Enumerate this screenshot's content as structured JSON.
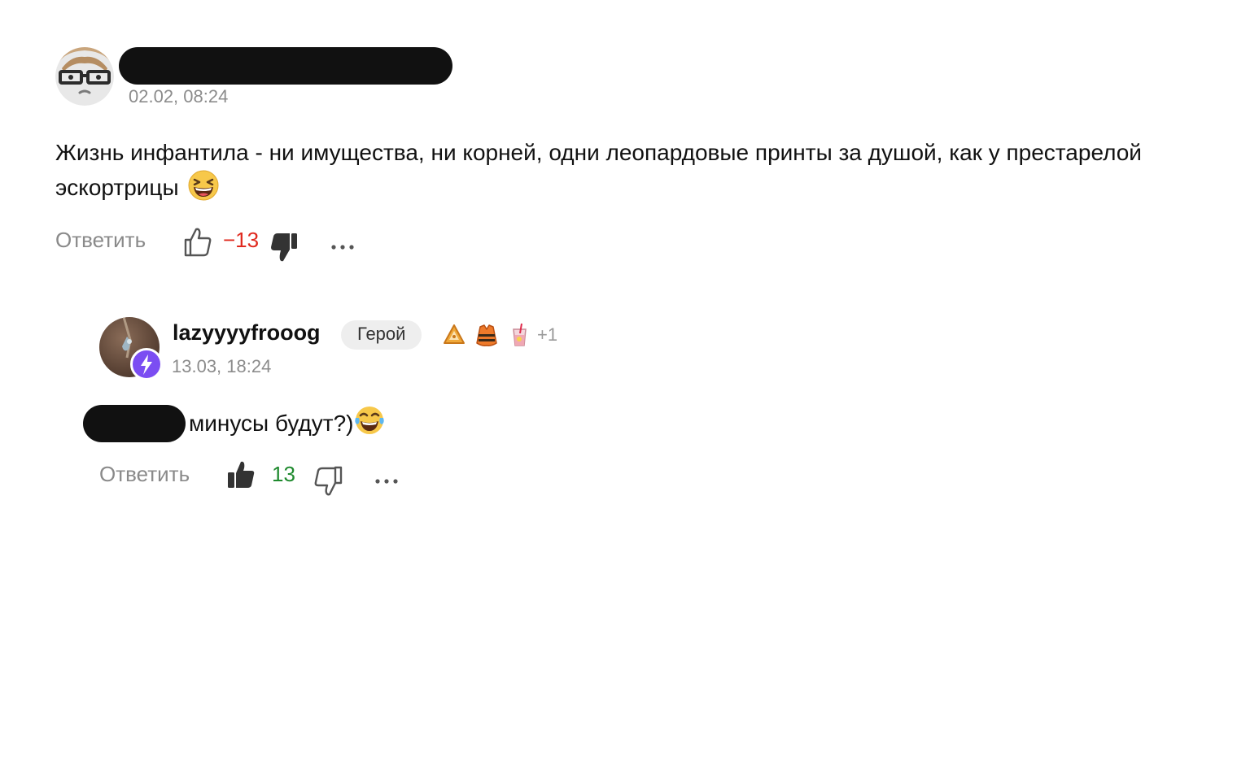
{
  "comments": [
    {
      "author_redacted": true,
      "date": "02.02, 08:24",
      "text": "Жизнь инфантила - ни имущества, ни корней, одни леопардовые принты за душой, как у престарелой эскортрицы",
      "emoji": "grinning-squinting-face",
      "reply_label": "Ответить",
      "score": "−13",
      "score_color": "#e0291e",
      "vote_state": "disliked"
    },
    {
      "author": "lazyyyyfrooog",
      "badge": "Герой",
      "awards": [
        "pastry-award",
        "life-vest-award",
        "drink-cup-award"
      ],
      "awards_more": "+1",
      "date": "13.03, 18:24",
      "text": "минусы будут?)",
      "mention_redacted": true,
      "emoji": "face-with-tears-of-joy",
      "reply_label": "Ответить",
      "score": "13",
      "score_color": "#1f8a2e",
      "vote_state": "liked"
    }
  ],
  "icons": {
    "like": "thumbs-up-icon",
    "dislike": "thumbs-down-icon",
    "more": "more-dots-icon",
    "author_badge": "lightning-bolt-icon"
  }
}
